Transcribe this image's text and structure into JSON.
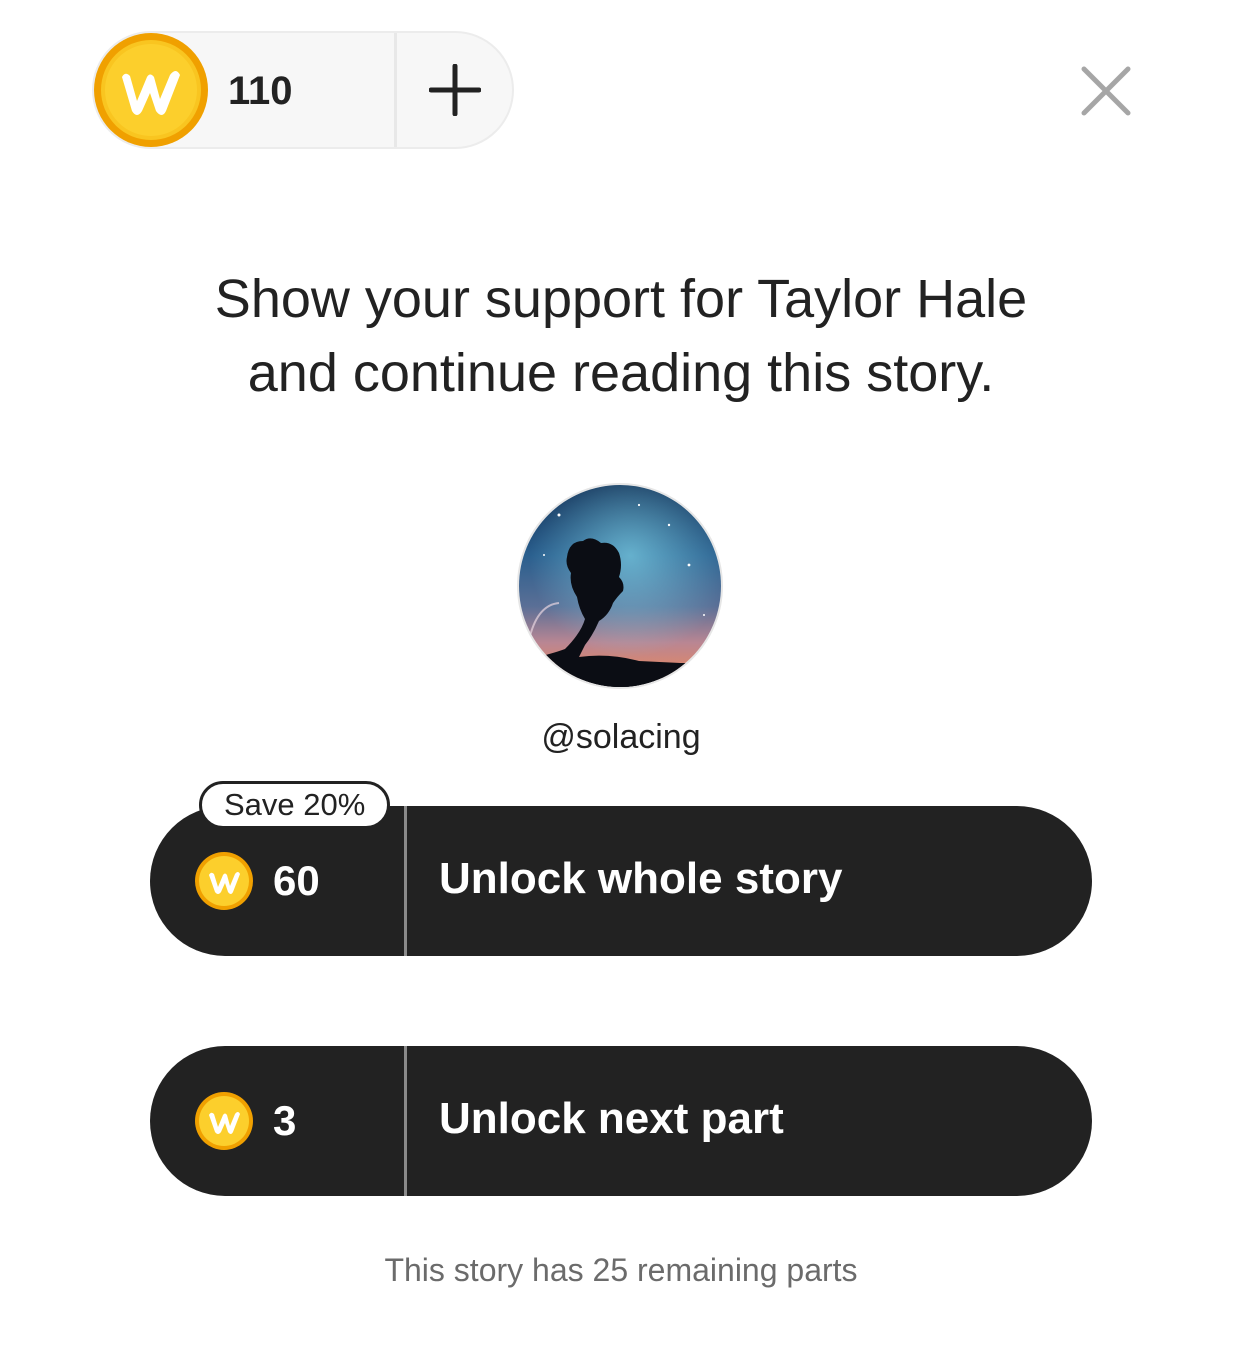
{
  "wallet": {
    "balance": "110",
    "add_icon": "plus-icon",
    "coin_icon": "wattpad-coin-icon",
    "coin_letter": "W"
  },
  "close_icon": "close-icon",
  "heading": {
    "line1": "Show your support for Taylor Hale",
    "line2": "and continue reading this story."
  },
  "author": {
    "username": "@solacing",
    "avatar": "author-avatar"
  },
  "offers": {
    "whole": {
      "badge": "Save 20%",
      "price": "60",
      "label": "Unlock whole story"
    },
    "part": {
      "price": "3",
      "label": "Unlock next part"
    }
  },
  "footer": {
    "remaining": "This story has 25 remaining parts"
  },
  "colors": {
    "button_bg": "#222222",
    "coin_gold": "#f7c21b",
    "coin_outer": "#f0a400",
    "muted_text": "#6b6b6b"
  }
}
